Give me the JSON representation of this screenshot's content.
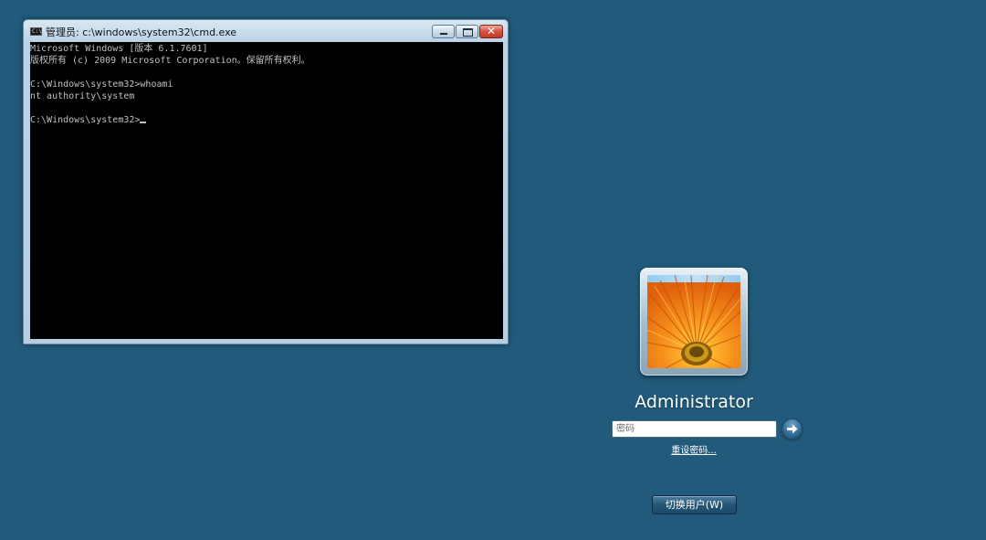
{
  "cmd_window": {
    "title": "管理员: c:\\windows\\system32\\cmd.exe",
    "icon": "cmd-console-icon",
    "icon_text": "C:\\",
    "close_glyph": "✕",
    "console_lines": [
      "Microsoft Windows [版本 6.1.7601]",
      "版权所有 (c) 2009 Microsoft Corporation。保留所有权利。",
      "",
      "C:\\Windows\\system32>whoami",
      "nt authority\\system",
      "",
      "C:\\Windows\\system32>"
    ]
  },
  "logon": {
    "username": "Administrator",
    "password_placeholder": "密码",
    "reset_password_label": "重设密码...",
    "switch_user_label": "切换用户(W)",
    "avatar_icon": "orange-flower-avatar"
  },
  "colors": {
    "desktop_background": "#215a7b",
    "console_background": "#000000",
    "console_text": "#c0c0c0"
  }
}
